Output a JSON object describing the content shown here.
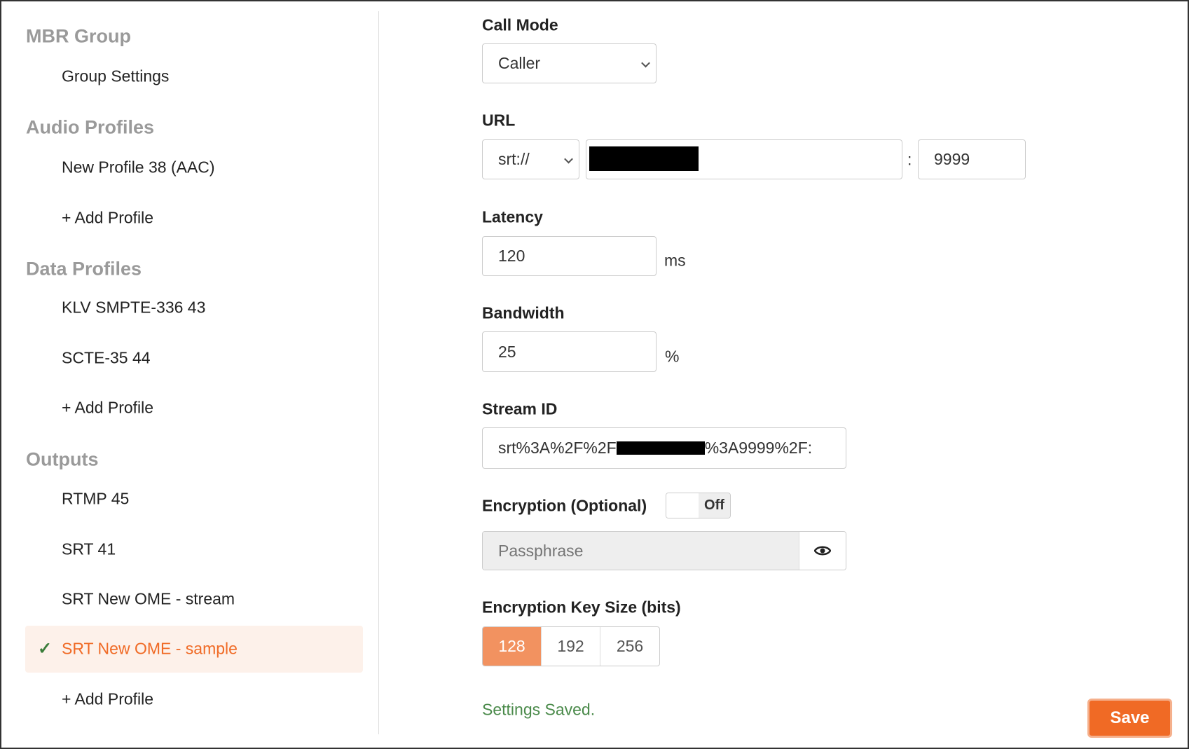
{
  "sidebar": {
    "sections": [
      {
        "heading": "MBR Group",
        "items": [
          "Group Settings"
        ]
      },
      {
        "heading": "Audio Profiles",
        "items": [
          "New Profile 38 (AAC)",
          "+ Add Profile"
        ]
      },
      {
        "heading": "Data Profiles",
        "items": [
          "KLV SMPTE-336 43",
          "SCTE-35 44",
          "+ Add Profile"
        ]
      },
      {
        "heading": "Outputs",
        "items": [
          "RTMP 45",
          "SRT 41",
          "SRT New OME - stream",
          "SRT New OME - sample",
          "+ Add Profile"
        ]
      }
    ],
    "selected": "SRT New OME - sample",
    "accent": "#f06a25",
    "check_color": "#3a7d3a"
  },
  "form": {
    "call_mode": {
      "label": "Call Mode",
      "value": "Caller"
    },
    "url": {
      "label": "URL",
      "scheme": "srt://",
      "separator": ":",
      "port": "9999"
    },
    "latency": {
      "label": "Latency",
      "value": "120",
      "unit": "ms"
    },
    "bandwidth": {
      "label": "Bandwidth",
      "value": "25",
      "unit": "%"
    },
    "stream_id": {
      "label": "Stream ID",
      "prefix": "srt%3A%2F%2F",
      "suffix": "%3A9999%2F:"
    },
    "encryption": {
      "label": "Encryption (Optional)",
      "toggle": "Off",
      "passphrase_placeholder": "Passphrase"
    },
    "key_size": {
      "label": "Encryption Key Size (bits)",
      "options": [
        "128",
        "192",
        "256"
      ],
      "selected": "128"
    },
    "status": "Settings Saved.",
    "save_label": "Save"
  }
}
